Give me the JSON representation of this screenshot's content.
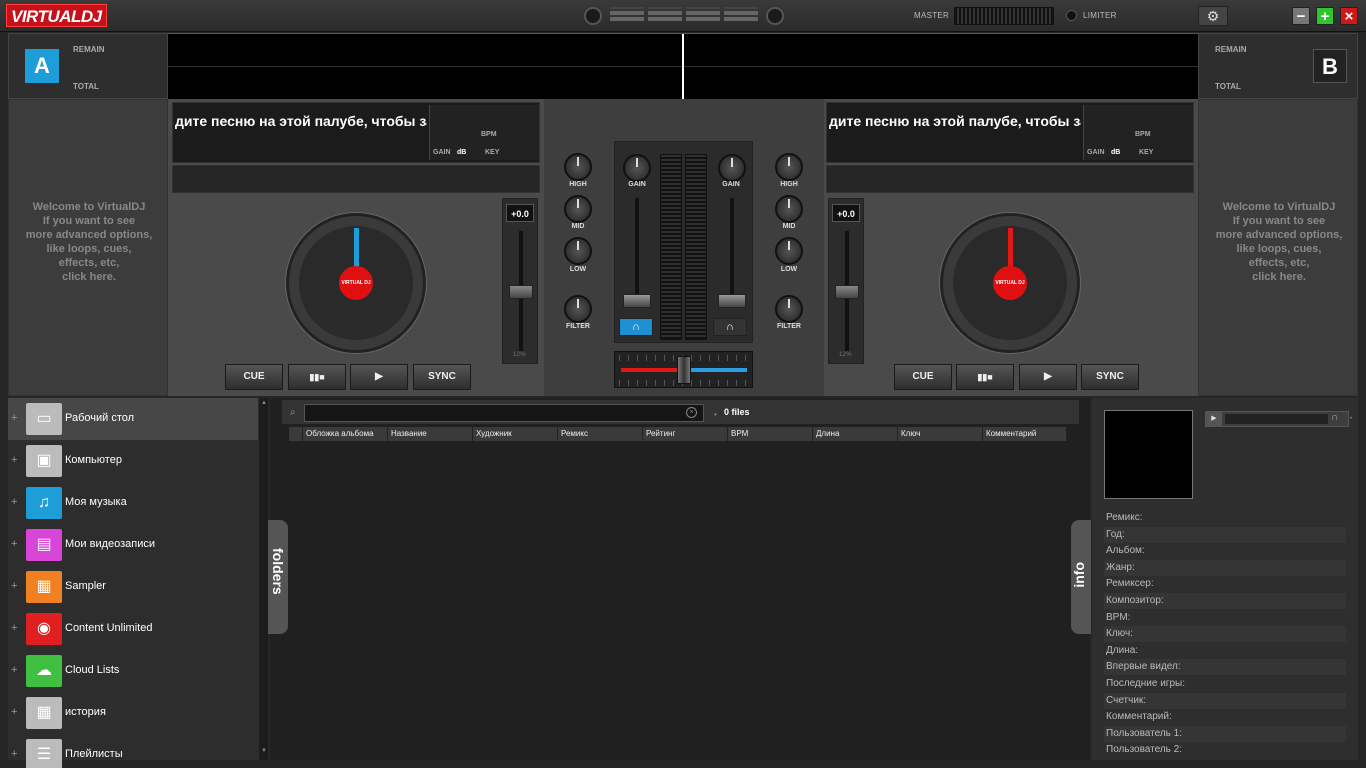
{
  "app": {
    "logo": "VIRTUALDJ",
    "master_label": "MASTER",
    "limiter_label": "LIMITER"
  },
  "decks": [
    {
      "letter": "A",
      "remain_label": "REMAIN",
      "total_label": "TOTAL",
      "scroll_text": "дите песню на этой палубе, чтобы за",
      "bpm_label": "BPM",
      "gain_label": "GAIN",
      "db_label": "dB",
      "key_label": "KEY",
      "pitch_value": "+0.0",
      "pitch_range": "12%",
      "platter_label": "VIRTUAL DJ",
      "marker_color": "#1e9ed8",
      "buttons": {
        "cue": "CUE",
        "pause": "▮▮■",
        "play": "▶",
        "sync": "SYNC"
      }
    },
    {
      "letter": "B",
      "remain_label": "REMAIN",
      "total_label": "TOTAL",
      "scroll_text": "дите песню на этой палубе, чтобы за",
      "bpm_label": "BPM",
      "gain_label": "GAIN",
      "db_label": "dB",
      "key_label": "KEY",
      "pitch_value": "+0.0",
      "pitch_range": "12%",
      "platter_label": "VIRTUAL DJ",
      "marker_color": "#e01818",
      "buttons": {
        "cue": "CUE",
        "pause": "▮▮■",
        "play": "▶",
        "sync": "SYNC"
      }
    }
  ],
  "welcome": [
    "Welcome to VirtualDJ",
    "If you want to see",
    "more advanced options,",
    "like loops, cues,",
    "effects, etc,",
    "click here."
  ],
  "mixer": {
    "high": "HIGH",
    "mid": "MID",
    "low": "LOW",
    "filter": "FILTER",
    "gain": "GAIN",
    "headphone_icon": "∩"
  },
  "folders": [
    {
      "name": "Рабочий стол",
      "icon": "desktop-icon",
      "color": "#bbbbbb",
      "glyph": "▭"
    },
    {
      "name": "Компьютер",
      "icon": "computer-icon",
      "color": "#bbbbbb",
      "glyph": "▣"
    },
    {
      "name": "Моя музыка",
      "icon": "music-icon",
      "color": "#1e9ed8",
      "glyph": "♫"
    },
    {
      "name": "Мои видеозаписи",
      "icon": "video-icon",
      "color": "#d845d8",
      "glyph": "▤"
    },
    {
      "name": "Sampler",
      "icon": "sampler-icon",
      "color": "#f08020",
      "glyph": "▦"
    },
    {
      "name": "Content Unlimited",
      "icon": "globe-icon",
      "color": "#e02020",
      "glyph": "◉"
    },
    {
      "name": "Cloud Lists",
      "icon": "cloud-icon",
      "color": "#40c040",
      "glyph": "☁"
    },
    {
      "name": "история",
      "icon": "calendar-icon",
      "color": "#bbbbbb",
      "glyph": "▦"
    },
    {
      "name": "Плейлисты",
      "icon": "playlist-icon",
      "color": "#bbbbbb",
      "glyph": "☰"
    }
  ],
  "browser": {
    "folders_tab": "folders",
    "info_tab": "info",
    "files_count": "0 files",
    "columns": [
      "Обложка альбома",
      "Название",
      "Художник",
      "Ремикс",
      "Рейтинг",
      "BPM",
      "Длина",
      "Ключ",
      "Комментарий"
    ]
  },
  "info": {
    "fields": [
      "Ремикс:",
      "Год:",
      "Альбом:",
      "Жанр:",
      "Ремиксер:",
      "Композитор:",
      "BPM:",
      "Ключ:",
      "Длина:",
      "Впервые видел:",
      "Последние игры:",
      "Счетчик:",
      "Комментарий:",
      "Пользователь 1:",
      "Пользователь 2:"
    ]
  }
}
